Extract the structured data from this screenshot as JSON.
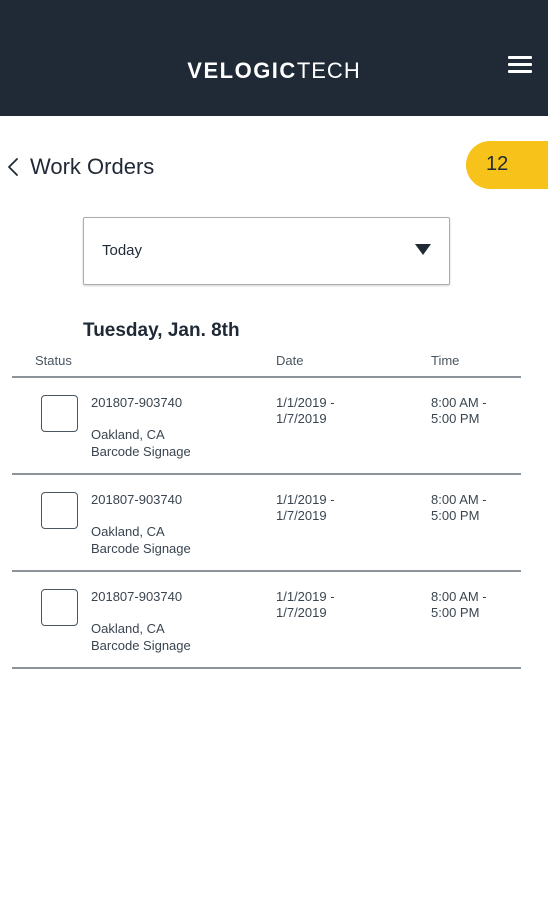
{
  "header": {
    "logo_bold": "VELOGIC",
    "logo_light": "TECH",
    "menu_icon": "hamburger-menu-icon"
  },
  "page": {
    "title": "Work Orders",
    "count_badge": "12",
    "back_icon": "chevron-left-icon"
  },
  "filter": {
    "selected": "Today"
  },
  "day_title": "Tuesday, Jan. 8th",
  "table": {
    "columns": [
      "Status",
      "Date",
      "Time"
    ],
    "rows": [
      {
        "id": "201807-903740",
        "location": "Oakland, CA",
        "type": "Barcode Signage",
        "date_start": "1/1/2019 -",
        "date_end": "1/7/2019",
        "time_start": "8:00 AM -",
        "time_end": "5:00 PM"
      },
      {
        "id": "201807-903740",
        "location": "Oakland, CA",
        "type": "Barcode Signage",
        "date_start": "1/1/2019 -",
        "date_end": "1/7/2019",
        "time_start": "8:00 AM -",
        "time_end": "5:00 PM"
      },
      {
        "id": "201807-903740",
        "location": "Oakland, CA",
        "type": "Barcode Signage",
        "date_start": "1/1/2019 -",
        "date_end": "1/7/2019",
        "time_start": "8:00 AM -",
        "time_end": "5:00 PM"
      }
    ]
  },
  "colors": {
    "topbar": "#1f2a36",
    "badge": "#f7c21a",
    "text": "#1f2a36"
  }
}
